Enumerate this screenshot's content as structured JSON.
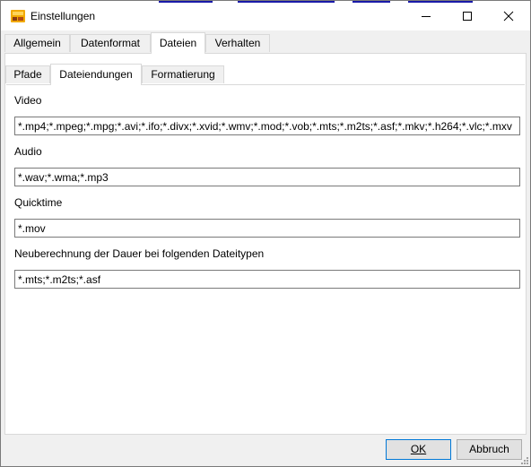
{
  "window": {
    "title": "Einstellungen"
  },
  "main_tabs": [
    {
      "label": "Allgemein"
    },
    {
      "label": "Datenformat"
    },
    {
      "label": "Dateien"
    },
    {
      "label": "Verhalten"
    }
  ],
  "sub_tabs": [
    {
      "label": "Pfade"
    },
    {
      "label": "Dateiendungen"
    },
    {
      "label": "Formatierung"
    }
  ],
  "fields": [
    {
      "label": "Video",
      "value": "*.mp4;*.mpeg;*.mpg;*.avi;*.ifo;*.divx;*.xvid;*.wmv;*.mod;*.vob;*.mts;*.m2ts;*.asf;*.mkv;*.h264;*.vlc;*.mxv"
    },
    {
      "label": "Audio",
      "value": "*.wav;*.wma;*.mp3"
    },
    {
      "label": "Quicktime",
      "value": "*.mov"
    },
    {
      "label": "Neuberechnung der Dauer bei folgenden Dateitypen",
      "value": "*.mts;*.m2ts;*.asf"
    }
  ],
  "buttons": {
    "ok": "OK",
    "cancel": "Abbruch"
  },
  "colors": {
    "focus_border": "#0078d7",
    "window_bg": "#f0f0f0",
    "app_icon": "#f2a900"
  }
}
